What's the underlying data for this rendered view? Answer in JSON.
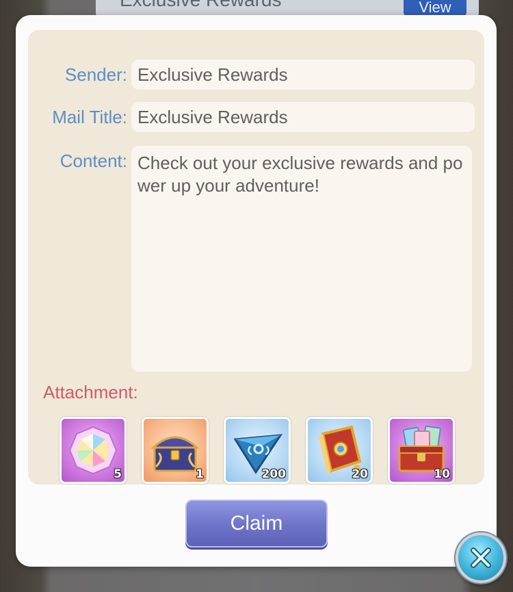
{
  "background": {
    "header_title": "Exclusive Rewards",
    "view_button_label": "View"
  },
  "mail": {
    "sender_label": "Sender:",
    "sender_value": "Exclusive Rewards",
    "title_label": "Mail Title:",
    "title_value": "Exclusive Rewards",
    "content_label": "Content:",
    "content_value": "Check out your exclusive rewards and power up your adventure!",
    "attachment_label": "Attachment:",
    "attachments": [
      {
        "icon": "gem-icon",
        "quantity": "5",
        "bg": "purple"
      },
      {
        "icon": "treasure-chest-icon",
        "quantity": "1",
        "bg": "orange"
      },
      {
        "icon": "blue-triangle-crystal-icon",
        "quantity": "200",
        "bg": "blue"
      },
      {
        "icon": "spell-book-icon",
        "quantity": "20",
        "bg": "blue"
      },
      {
        "icon": "card-chest-icon",
        "quantity": "10",
        "bg": "purple"
      }
    ],
    "claim_label": "Claim"
  },
  "colors": {
    "label_blue": "#5a8fc7",
    "attachment_red": "#cf5c6a",
    "claim_button": "#6d73c8",
    "panel_beige": "#f0e8d8"
  },
  "icons": {
    "close": "close-x-icon"
  }
}
